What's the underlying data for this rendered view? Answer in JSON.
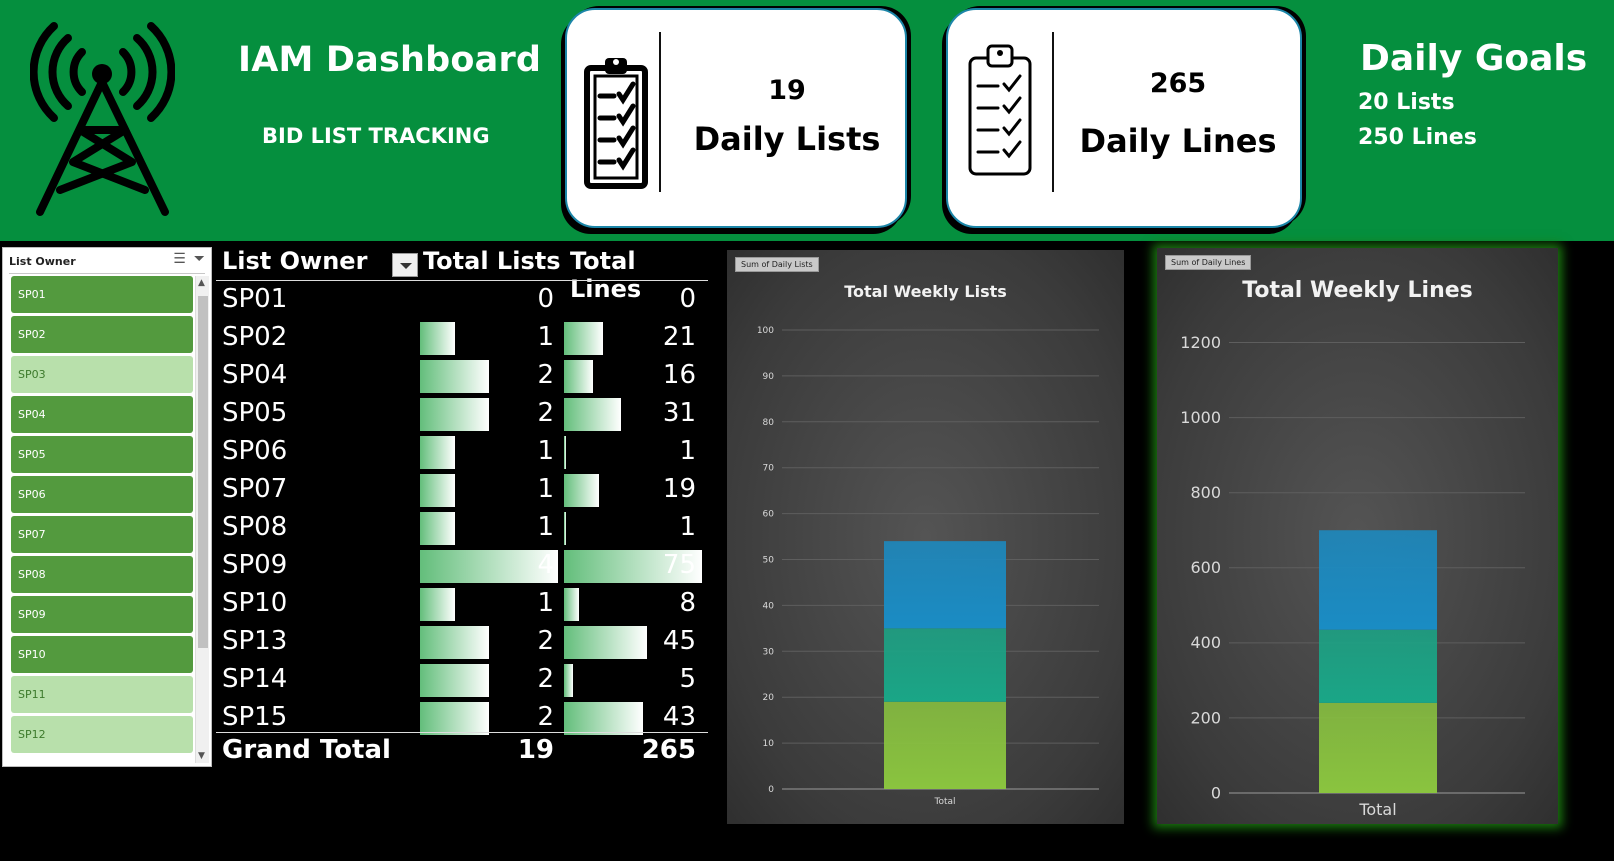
{
  "header": {
    "title": "IAM Dashboard",
    "subtitle": "BID LIST  TRACKING",
    "kpi_lists": {
      "value": "19",
      "label": "Daily Lists",
      "icon": "clipboard-checklist-icon"
    },
    "kpi_lines": {
      "value": "265",
      "label": "Daily Lines",
      "icon": "clipboard-checklist-icon"
    },
    "goals": {
      "title": "Daily Goals",
      "lists": "20 Lists",
      "lines": "250 Lines"
    },
    "logo_icon": "radio-tower-icon",
    "band_color": "#058f3e"
  },
  "slicer": {
    "title": "List Owner",
    "icons": [
      "multi-select-icon",
      "clear-filter-icon"
    ],
    "items": [
      {
        "label": "SP01",
        "selected": true
      },
      {
        "label": "SP02",
        "selected": true
      },
      {
        "label": "SP03",
        "selected": false
      },
      {
        "label": "SP04",
        "selected": true
      },
      {
        "label": "SP05",
        "selected": true
      },
      {
        "label": "SP06",
        "selected": true
      },
      {
        "label": "SP07",
        "selected": true
      },
      {
        "label": "SP08",
        "selected": true
      },
      {
        "label": "SP09",
        "selected": true
      },
      {
        "label": "SP10",
        "selected": true
      },
      {
        "label": "SP11",
        "selected": false
      },
      {
        "label": "SP12",
        "selected": false
      }
    ]
  },
  "pivot": {
    "headers": {
      "owner": "List Owner",
      "lists": "Total Lists",
      "lines": "Total Lines"
    },
    "rows": [
      {
        "owner": "SP01",
        "lists": 0,
        "lines": 0
      },
      {
        "owner": "SP02",
        "lists": 1,
        "lines": 21
      },
      {
        "owner": "SP04",
        "lists": 2,
        "lines": 16
      },
      {
        "owner": "SP05",
        "lists": 2,
        "lines": 31
      },
      {
        "owner": "SP06",
        "lists": 1,
        "lines": 1
      },
      {
        "owner": "SP07",
        "lists": 1,
        "lines": 19
      },
      {
        "owner": "SP08",
        "lists": 1,
        "lines": 1
      },
      {
        "owner": "SP09",
        "lists": 4,
        "lines": 75
      },
      {
        "owner": "SP10",
        "lists": 1,
        "lines": 8
      },
      {
        "owner": "SP13",
        "lists": 2,
        "lines": 45
      },
      {
        "owner": "SP14",
        "lists": 2,
        "lines": 5
      },
      {
        "owner": "SP15",
        "lists": 2,
        "lines": 43
      }
    ],
    "grand_total": {
      "label": "Grand Total",
      "lists": "19",
      "lines": "265"
    },
    "databar_colors": [
      "#63be7b",
      "#ffffff"
    ]
  },
  "chart_data": [
    {
      "type": "bar",
      "title": "Total Weekly Lists",
      "field_button": "Sum of Daily Lists",
      "categories": [
        "Total"
      ],
      "stacked": true,
      "series": [
        {
          "values": [
            19
          ],
          "color": "#8ac43f"
        },
        {
          "values": [
            16
          ],
          "color": "#1aa687"
        },
        {
          "values": [
            19
          ],
          "color": "#1a8cc4"
        }
      ],
      "ylim": [
        0,
        100
      ],
      "yticks": [
        0,
        10,
        20,
        30,
        40,
        50,
        60,
        70,
        80,
        90,
        100
      ],
      "grid": true
    },
    {
      "type": "bar",
      "title": "Total Weekly Lines",
      "field_button": "Sum of Daily Lines",
      "categories": [
        "Total"
      ],
      "stacked": true,
      "series": [
        {
          "values": [
            240
          ],
          "color": "#8ac43f"
        },
        {
          "values": [
            195
          ],
          "color": "#1aa687"
        },
        {
          "values": [
            265
          ],
          "color": "#1a8cc4"
        }
      ],
      "ylim": [
        0,
        1300
      ],
      "yticks": [
        0,
        200,
        400,
        600,
        800,
        1000,
        1200
      ],
      "grid": true
    }
  ]
}
